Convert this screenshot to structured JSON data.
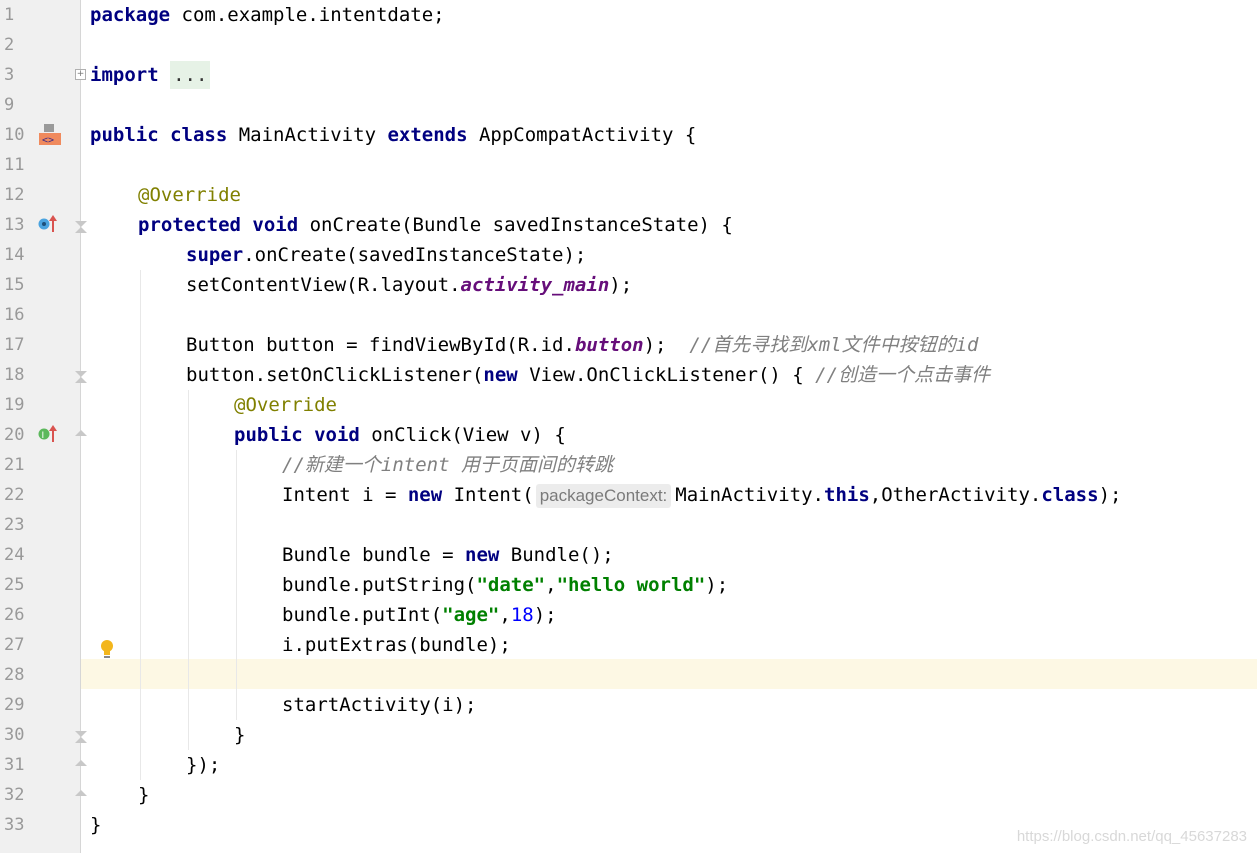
{
  "editor": {
    "line_numbers": [
      "1",
      "2",
      "3",
      "9",
      "10",
      "11",
      "12",
      "13",
      "14",
      "15",
      "16",
      "17",
      "18",
      "19",
      "20",
      "21",
      "22",
      "23",
      "24",
      "25",
      "26",
      "27",
      "28",
      "29",
      "30",
      "31",
      "32",
      "33"
    ],
    "lines": {
      "l1": {
        "kw": "package",
        "rest": " com.example.intentdate;"
      },
      "l3": {
        "kw": "import",
        "folded": "..."
      },
      "l10": {
        "kw1": "public",
        "kw2": "class",
        "name": " MainActivity ",
        "kw3": "extends",
        "rest": " AppCompatActivity {"
      },
      "l12": {
        "ann": "@Override"
      },
      "l13": {
        "kw1": "protected",
        "kw2": "void",
        "rest": " onCreate(Bundle savedInstanceState) {"
      },
      "l14": {
        "kw": "super",
        "rest": ".onCreate(savedInstanceState);"
      },
      "l15": {
        "pre": "setContentView(R.layout.",
        "field": "activity_main",
        "post": ");"
      },
      "l17": {
        "pre": "Button button = findViewById(R.id.",
        "field": "button",
        "post": ");  ",
        "comment_a": "//",
        "comment_b": "首先寻找到",
        "comment_c": "xml",
        "comment_d": "文件中按钮的",
        "comment_e": "id"
      },
      "l18": {
        "pre": "button.setOnClickListener(",
        "kw": "new",
        "post": " View.OnClickListener() { ",
        "comment_a": "//",
        "comment_b": "创造一个点击事件"
      },
      "l19": {
        "ann": "@Override"
      },
      "l20": {
        "kw1": "public",
        "kw2": "void",
        "rest": " onClick(View v) {"
      },
      "l21": {
        "comment_a": "//",
        "comment_b": "新建一个",
        "comment_c": "intent ",
        "comment_d": "用于页面间的转跳"
      },
      "l22": {
        "pre": "Intent i = ",
        "kw": "new",
        "mid": " Intent(",
        "hint": "packageContext:",
        "post1": "MainActivity.",
        "kw2": "this",
        "post2": ",OtherActivity.",
        "kw3": "class",
        "post3": ");"
      },
      "l24": {
        "pre": "Bundle bundle = ",
        "kw": "new",
        "post": " Bundle();"
      },
      "l25": {
        "pre": "bundle.putString(",
        "s1": "\"date\"",
        "comma": ",",
        "s2": "\"hello world\"",
        "post": ");"
      },
      "l26": {
        "pre": "bundle.putInt(",
        "s1": "\"age\"",
        "comma": ",",
        "num": "18",
        "post": ");"
      },
      "l27": {
        "text": "i.putExtras(bundle);"
      },
      "l29": {
        "text": "startActivity(i);"
      },
      "l30": {
        "text": "}"
      },
      "l31": {
        "text": "});"
      },
      "l32": {
        "text": "}"
      },
      "l33": {
        "text": "}"
      }
    },
    "gutter_icons": {
      "class_icon": "java-class-gutter-icon",
      "override_icon_13": "overrides-method-icon",
      "implements_icon_20": "implements-method-icon",
      "bulb": "intention-lightbulb-icon"
    },
    "colors": {
      "keyword": "#000080",
      "annotation": "#808000",
      "string": "#008000",
      "number": "#0000ff",
      "field": "#660e7a",
      "comment": "#808080",
      "current_line": "#fdf8e4",
      "gutter": "#f0f0f0"
    }
  },
  "watermark": "https://blog.csdn.net/qq_45637283"
}
